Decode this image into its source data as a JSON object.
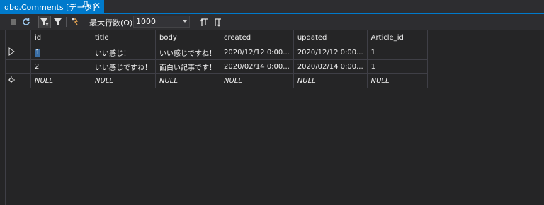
{
  "tab": {
    "title": "dbo.Comments [データ]",
    "pin": "ᵖ",
    "close": "✕"
  },
  "toolbar": {
    "max_rows_label": "最大行数(O):",
    "max_rows_value": "1000"
  },
  "grid": {
    "columns": [
      "id",
      "title",
      "body",
      "created",
      "updated",
      "Article_id"
    ],
    "rows": [
      {
        "id": "1",
        "title": "いい感じ！",
        "body": "いい感じですね！",
        "created": "2020/12/12 0:00...",
        "updated": "2020/12/12 0:00...",
        "article_id": "1"
      },
      {
        "id": "2",
        "title": "いい感じですね！",
        "body": "面白い記事です！",
        "created": "2020/02/14 0:00...",
        "updated": "2020/02/14 0:00...",
        "article_id": "1"
      }
    ],
    "new_row": {
      "id": "NULL",
      "title": "NULL",
      "body": "NULL",
      "created": "NULL",
      "updated": "NULL",
      "article_id": "NULL"
    }
  },
  "colors": {
    "accent": "#007acc",
    "background": "#252526",
    "grid_line": "#3f3f46"
  },
  "icons": [
    "stop-icon",
    "refresh-icon",
    "filter-icon",
    "filter-funnel-icon",
    "script-icon",
    "sort-left-icon",
    "sort-right-icon"
  ]
}
